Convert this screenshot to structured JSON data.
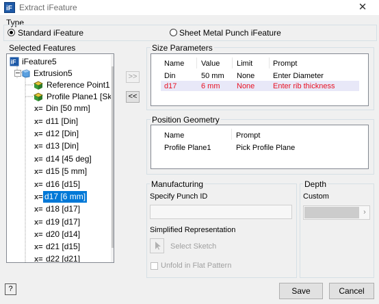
{
  "window": {
    "title": "Extract iFeature",
    "close_glyph": "✕"
  },
  "type_group": {
    "label": "Type",
    "options": [
      {
        "label": "Standard iFeature",
        "selected": true
      },
      {
        "label": "Sheet Metal Punch iFeature",
        "selected": false
      }
    ]
  },
  "selected_features": {
    "label": "Selected Features",
    "items": [
      {
        "label": "iFeature5",
        "icon": "ifeature-icon",
        "level": 0
      },
      {
        "label": "Extrusion5",
        "icon": "extrusion-icon",
        "level": 1
      },
      {
        "label": "Reference Point1 [R",
        "icon": "geometry-icon",
        "level": 2
      },
      {
        "label": "Profile Plane1 [Sketc",
        "icon": "geometry-icon",
        "level": 2
      },
      {
        "label": "Din [50 mm]",
        "icon": "parameter-icon",
        "level": 2
      },
      {
        "label": "d11 [Din]",
        "icon": "parameter-icon",
        "level": 2
      },
      {
        "label": "d12 [Din]",
        "icon": "parameter-icon",
        "level": 2
      },
      {
        "label": "d13 [Din]",
        "icon": "parameter-icon",
        "level": 2
      },
      {
        "label": "d14 [45 deg]",
        "icon": "parameter-icon",
        "level": 2
      },
      {
        "label": "d15 [5 mm]",
        "icon": "parameter-icon",
        "level": 2
      },
      {
        "label": "d16 [d15]",
        "icon": "parameter-icon",
        "level": 2
      },
      {
        "label": "d17 [6 mm]",
        "icon": "parameter-icon",
        "level": 2,
        "selected": true
      },
      {
        "label": "d18 [d17]",
        "icon": "parameter-icon",
        "level": 2
      },
      {
        "label": "d19 [d17]",
        "icon": "parameter-icon",
        "level": 2
      },
      {
        "label": "d20 [d14]",
        "icon": "parameter-icon",
        "level": 2
      },
      {
        "label": "d21 [d15]",
        "icon": "parameter-icon",
        "level": 2
      },
      {
        "label": "d22 [d21]",
        "icon": "parameter-icon",
        "level": 2
      }
    ],
    "param_glyph": "x="
  },
  "transfer": {
    "add_label": ">>",
    "remove_label": "<<"
  },
  "size_parameters": {
    "label": "Size Parameters",
    "columns": [
      "Name",
      "Value",
      "Limit",
      "Prompt"
    ],
    "rows": [
      {
        "name": "Din",
        "value": "50 mm",
        "limit": "None",
        "prompt": "Enter Diameter"
      },
      {
        "name": "d17",
        "value": "6 mm",
        "limit": "None",
        "prompt": "Enter rib thickness"
      }
    ]
  },
  "position_geometry": {
    "label": "Position Geometry",
    "columns": [
      "Name",
      "Prompt"
    ],
    "rows": [
      {
        "name": "Profile Plane1",
        "prompt": "Pick Profile Plane"
      }
    ]
  },
  "manufacturing": {
    "label": "Manufacturing",
    "punch_id_label": "Specify Punch ID",
    "punch_id_value": "",
    "simplified_label": "Simplified Representation",
    "select_sketch_label": "Select Sketch",
    "unfold_label": "Unfold in Flat Pattern"
  },
  "depth": {
    "label": "Depth",
    "mode_label": "Custom",
    "value": ""
  },
  "footer": {
    "help_label": "?",
    "save_label": "Save",
    "cancel_label": "Cancel"
  },
  "colors": {
    "selection": "#0078d7",
    "highlight_row": "#e8e8f8",
    "error_text": "#e81123"
  }
}
